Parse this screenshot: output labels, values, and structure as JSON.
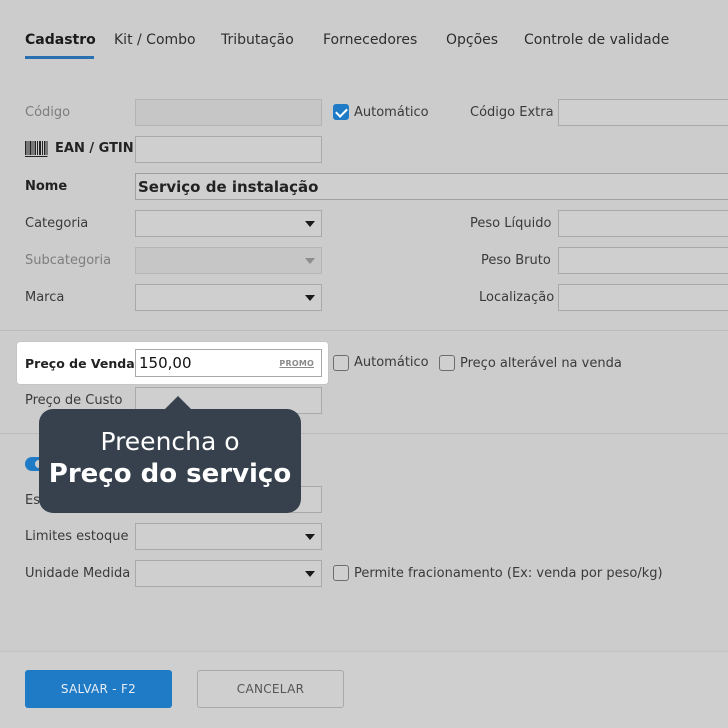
{
  "tabs": [
    {
      "label": "Cadastro"
    },
    {
      "label": "Kit / Combo"
    },
    {
      "label": "Tributação"
    },
    {
      "label": "Fornecedores"
    },
    {
      "label": "Opções"
    },
    {
      "label": "Controle de validade"
    }
  ],
  "form": {
    "codigo_label": "Código",
    "automatico_label": "Automático",
    "codigo_extra_label": "Código Extra",
    "ean_label": "EAN / GTIN",
    "nome_label": "Nome",
    "nome_value": "Serviço de instalação",
    "categoria_label": "Categoria",
    "peso_liquido_label": "Peso Líquido",
    "subcategoria_label": "Subcategoria",
    "peso_bruto_label": "Peso Bruto",
    "marca_label": "Marca",
    "localizacao_label": "Localização",
    "preco_venda_label": "Preço de Venda",
    "preco_venda_value": "150,00",
    "promo_label": "PROMO",
    "preco_automatico_label": "Automático",
    "preco_alteravel_label": "Preço alterável na venda",
    "preco_custo_label": "Preço de Custo",
    "estoque_label_partial": "Es",
    "limites_estoque_label": "Limites estoque",
    "unidade_medida_label": "Unidade Medida",
    "fracionamento_label": "Permite fracionamento (Ex: venda por peso/kg)"
  },
  "checks": {
    "codigo_automatico": true,
    "preco_automatico": false,
    "preco_alteravel": false,
    "permite_fracionamento": false
  },
  "tooltip": {
    "line1": "Preencha o",
    "line2": "Preço do serviço"
  },
  "footer": {
    "save_label": "SALVAR - F2",
    "cancel_label": "CANCELAR"
  },
  "colors": {
    "accent": "#1f7bc6",
    "tooltip_bg": "#36414d",
    "backdrop": "#cccccc"
  },
  "icons": {
    "barcode": "barcode-icon",
    "dropdown": "chevron-down-icon",
    "check": "checkmark-icon"
  }
}
